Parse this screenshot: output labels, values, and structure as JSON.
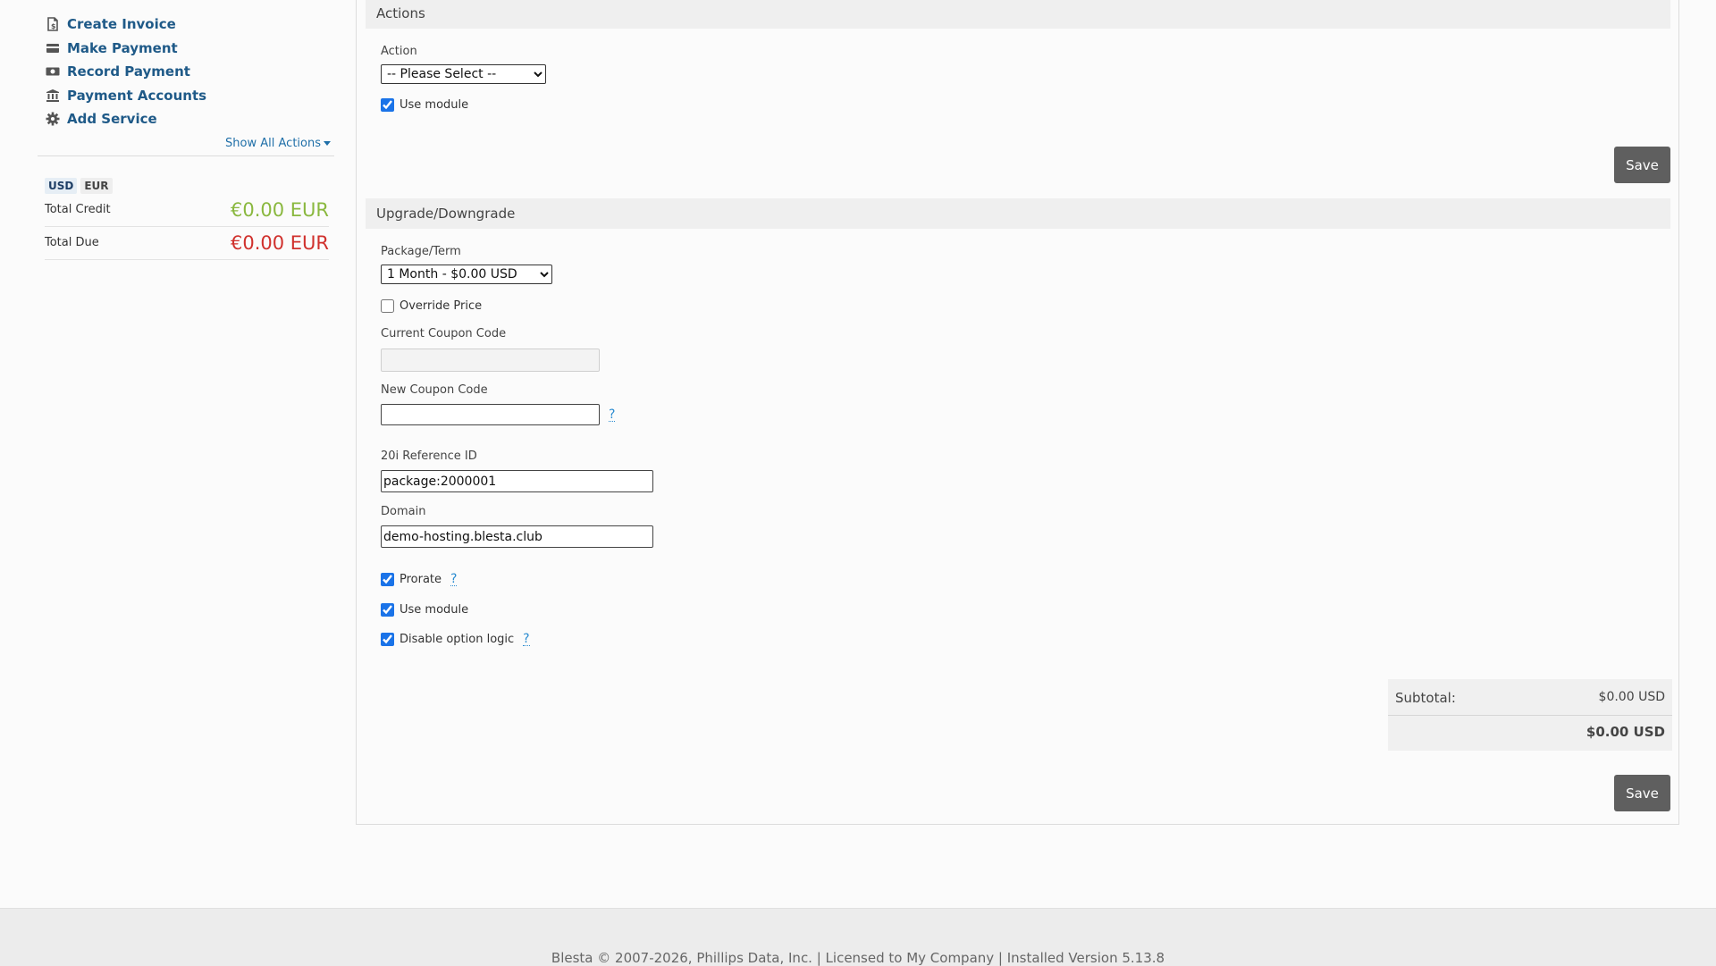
{
  "sidebar": {
    "actions": [
      {
        "label": "Create Invoice",
        "icon": "invoice-icon"
      },
      {
        "label": "Make Payment",
        "icon": "credit-card-icon"
      },
      {
        "label": "Record Payment",
        "icon": "money-icon"
      },
      {
        "label": "Payment Accounts",
        "icon": "bank-icon"
      },
      {
        "label": "Add Service",
        "icon": "gear-icon"
      }
    ],
    "show_all_label": "Show All Actions",
    "currency_tabs": [
      "USD",
      "EUR"
    ],
    "active_currency": "USD",
    "total_credit_label": "Total Credit",
    "total_credit_value": "€0.00 EUR",
    "total_due_label": "Total Due",
    "total_due_value": "€0.00 EUR"
  },
  "actions_section": {
    "title": "Actions",
    "action_label": "Action",
    "action_selected": "-- Please Select --",
    "use_module_label": "Use module",
    "use_module_checked": true,
    "save_label": "Save"
  },
  "upgrade_section": {
    "title": "Upgrade/Downgrade",
    "package_label": "Package/Term",
    "package_selected": "1 Month - $0.00 USD",
    "override_price_label": "Override Price",
    "override_price_checked": false,
    "current_coupon_label": "Current Coupon Code",
    "current_coupon_value": "",
    "new_coupon_label": "New Coupon Code",
    "new_coupon_value": "",
    "help_mark": "?",
    "reference_label": "20i Reference ID",
    "reference_value": "package:2000001",
    "domain_label": "Domain",
    "domain_value": "demo-hosting.blesta.club",
    "prorate_label": "Prorate",
    "prorate_checked": true,
    "use_module_label": "Use module",
    "use_module_checked": true,
    "disable_option_logic_label": "Disable option logic",
    "disable_option_logic_checked": true,
    "subtotal_label": "Subtotal:",
    "subtotal_value": "$0.00 USD",
    "total_value": "$0.00 USD",
    "save_label": "Save"
  },
  "footer": {
    "text": "Blesta © 2007-2026, Phillips Data, Inc. | Licensed to My Company | Installed Version 5.13.8"
  },
  "colors": {
    "link": "#1f5a88",
    "credit": "#8ab83f",
    "due": "#d0312d",
    "button": "#5f5f5f"
  }
}
